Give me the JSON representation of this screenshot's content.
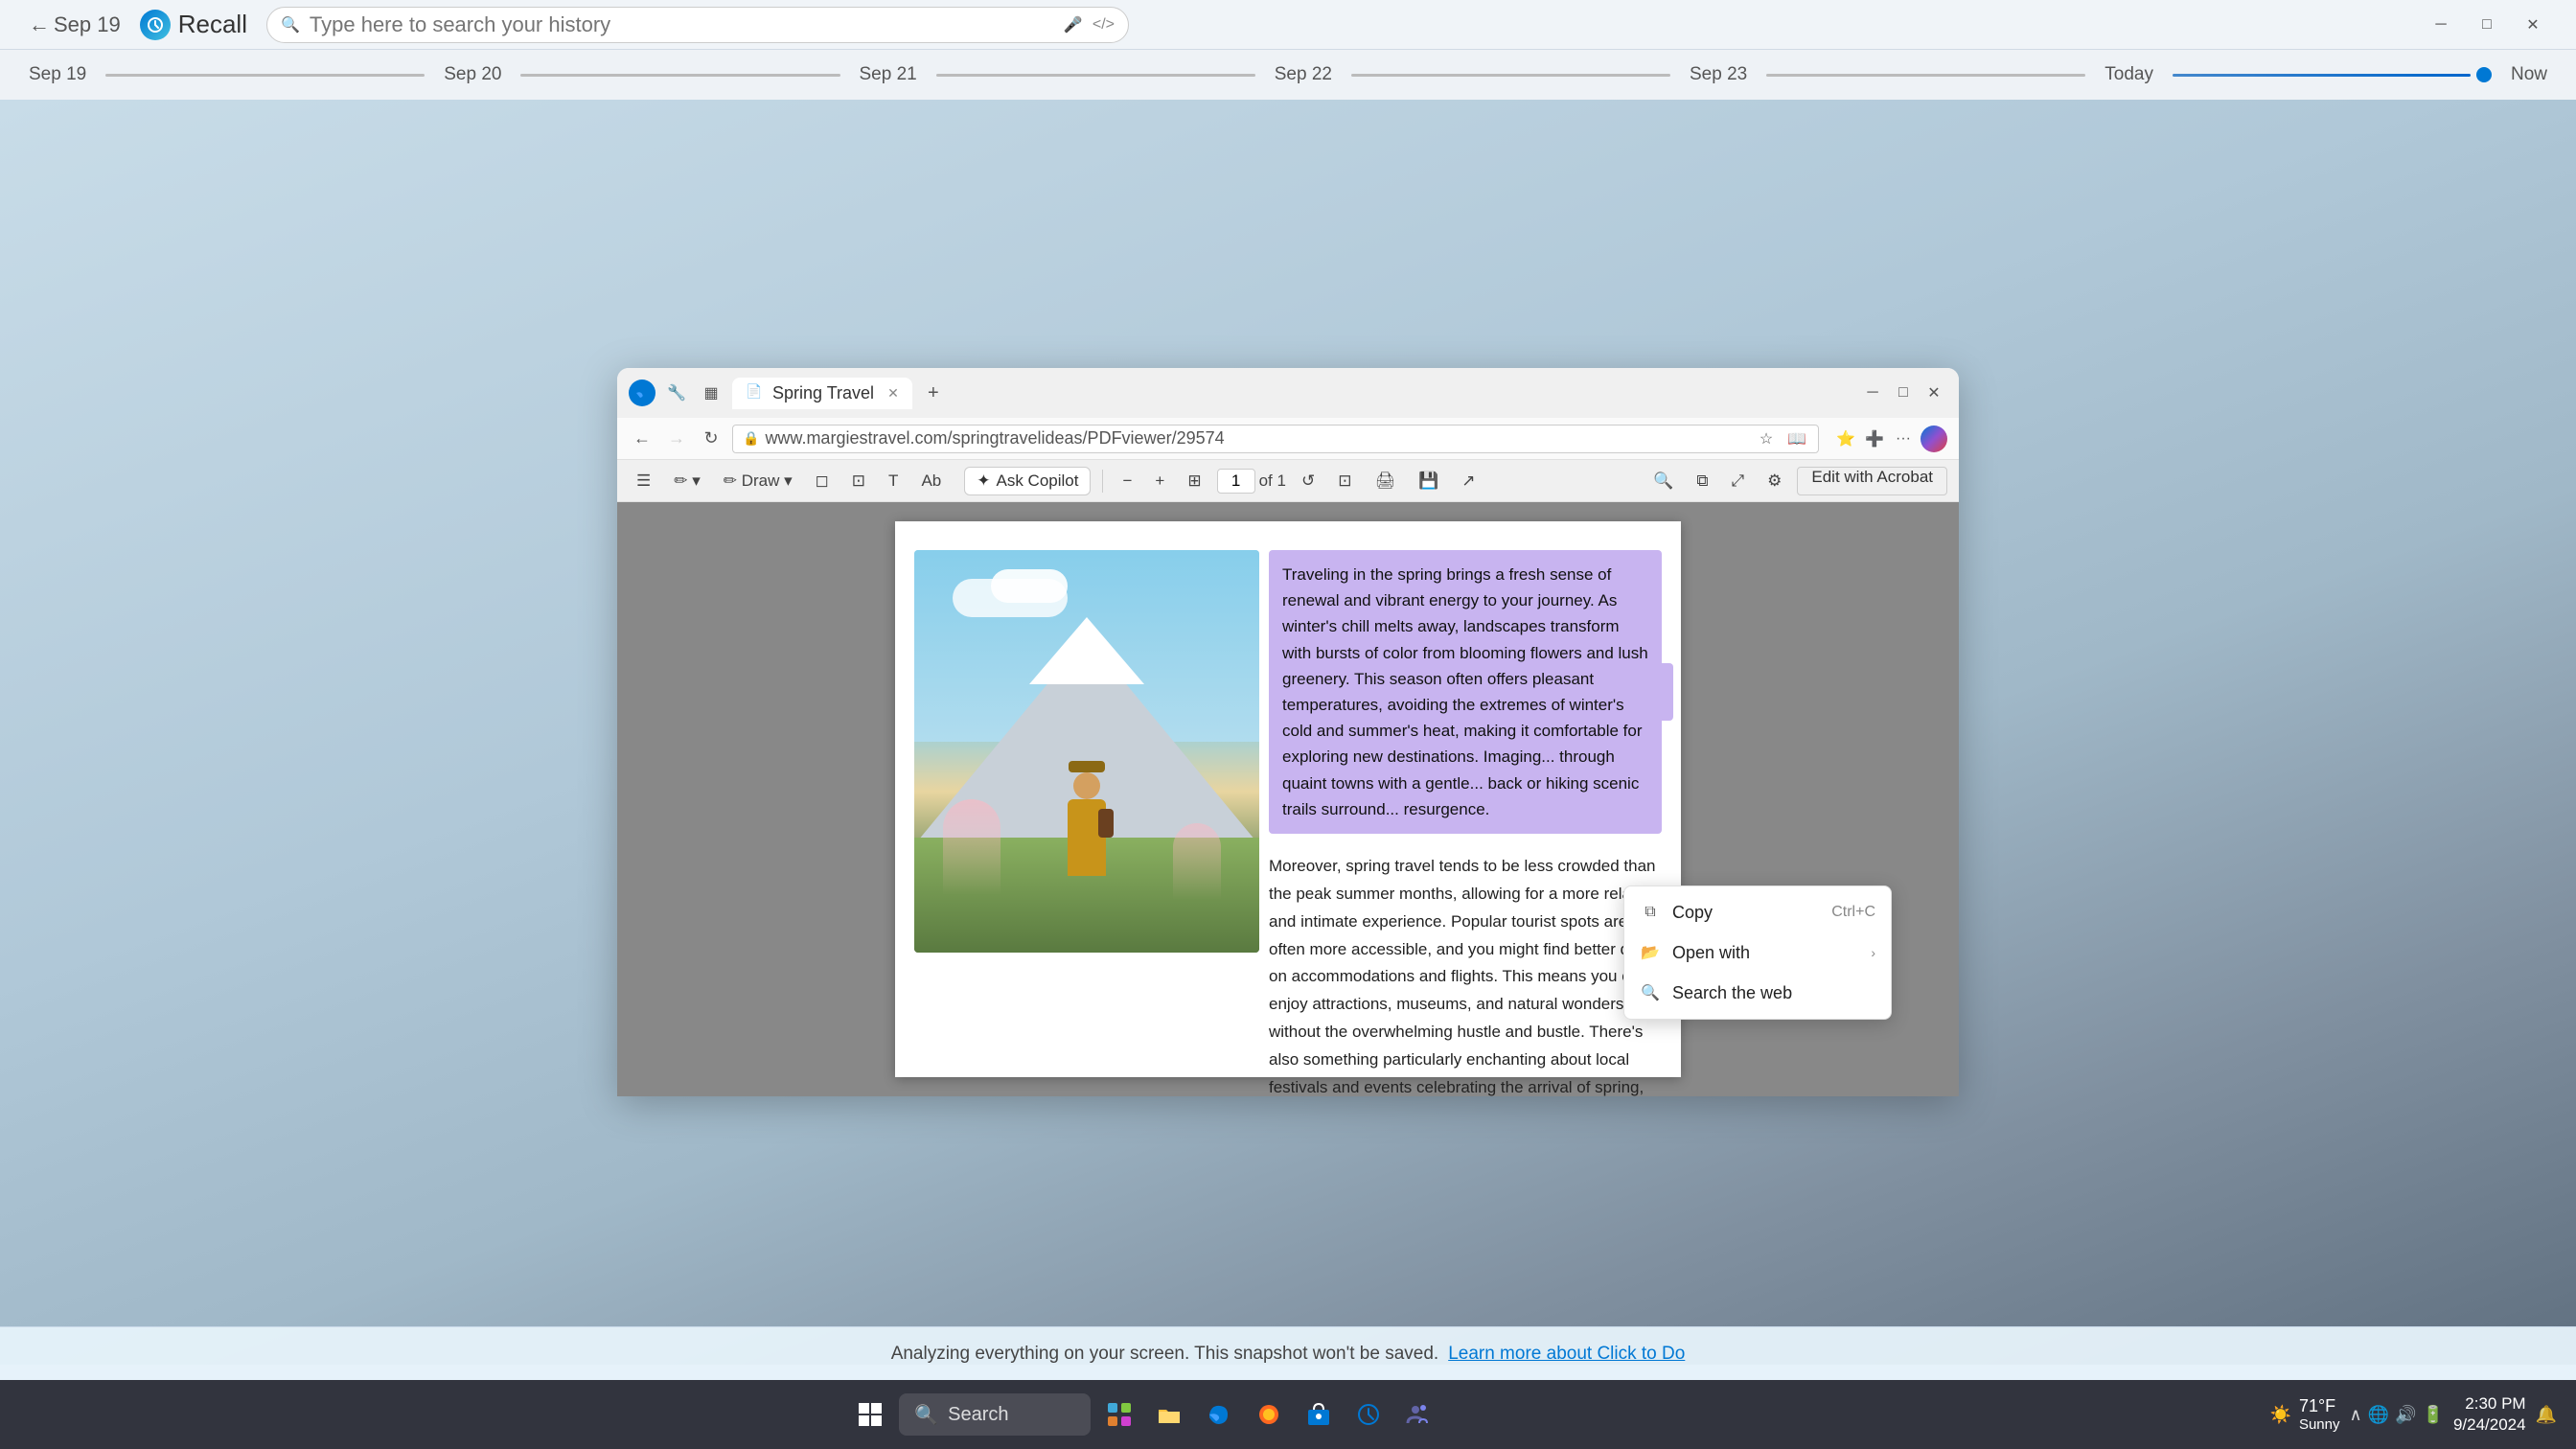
{
  "app": {
    "title": "Recall",
    "search_placeholder": "Type here to search your history"
  },
  "timeline": {
    "dates": [
      "Sep 19",
      "Sep 20",
      "Sep 21",
      "Sep 22",
      "Sep 23",
      "Today",
      "Now"
    ],
    "back_label": "Sep 19"
  },
  "browser": {
    "tab_title": "Spring Travel",
    "tab_new": "+",
    "address": "www.margiestravel.com/springtravelideas/PDFviewer/29574",
    "page_num": "1",
    "page_total": "of 1"
  },
  "pdf": {
    "title": "Spring Travel",
    "highlighted_text": "Traveling in the spring brings a fresh sense of renewal and vibrant energy to your journey. As winter's chill melts away, landscapes transform with bursts of color from blooming flowers and lush greenery. This season often offers pleasant temperatures, avoiding the extremes of winter's cold and summer's heat, making it comfortable for exploring new destinations. Imagin... through quaint towns with a gentle... back or hiking scenic trails surround... resurgence.",
    "body_text": "Moreover, spring travel tends to be less crowded than the peak summer months, allowing for a more relaxed and intimate experience. Popular tourist spots are often more accessible, and you might find better deals on accommodations and flights. This means you can enjoy attractions, museums, and natural wonders without the overwhelming hustle and bustle. There's also something particularly enchanting about local festivals and events celebrating the arrival of spring, which provide a deeper connection to the culture and traditions of the place you're visiting.",
    "copilot_label": "Ask Copilot",
    "edit_acrobat": "Edit with Acrobat"
  },
  "context_menu": {
    "items": [
      {
        "label": "Copy",
        "shortcut": "Ctrl+C",
        "icon": "📋"
      },
      {
        "label": "Open with",
        "icon": "📂",
        "has_arrow": true
      },
      {
        "label": "Search the web",
        "icon": "🔍"
      }
    ]
  },
  "notification": {
    "text": "Analyzing everything on your screen. This snapshot won't be saved.",
    "link": "Learn more about Click to Do"
  },
  "taskbar": {
    "search_label": "Search",
    "weather_temp": "71°F",
    "weather_condition": "Sunny",
    "time": "2:30 PM",
    "date": "9/24/2024"
  },
  "icons": {
    "back_arrow": "←",
    "search": "🔍",
    "mic": "🎤",
    "code": "</>",
    "minimize": "─",
    "maximize": "□",
    "close": "✕",
    "refresh": "↻",
    "home": "⌂",
    "star": "☆",
    "settings": "⚙",
    "chevron_right": "›",
    "copy": "⧉",
    "pdf": "📄",
    "windows": "⊞",
    "weather_sun": "☀"
  }
}
